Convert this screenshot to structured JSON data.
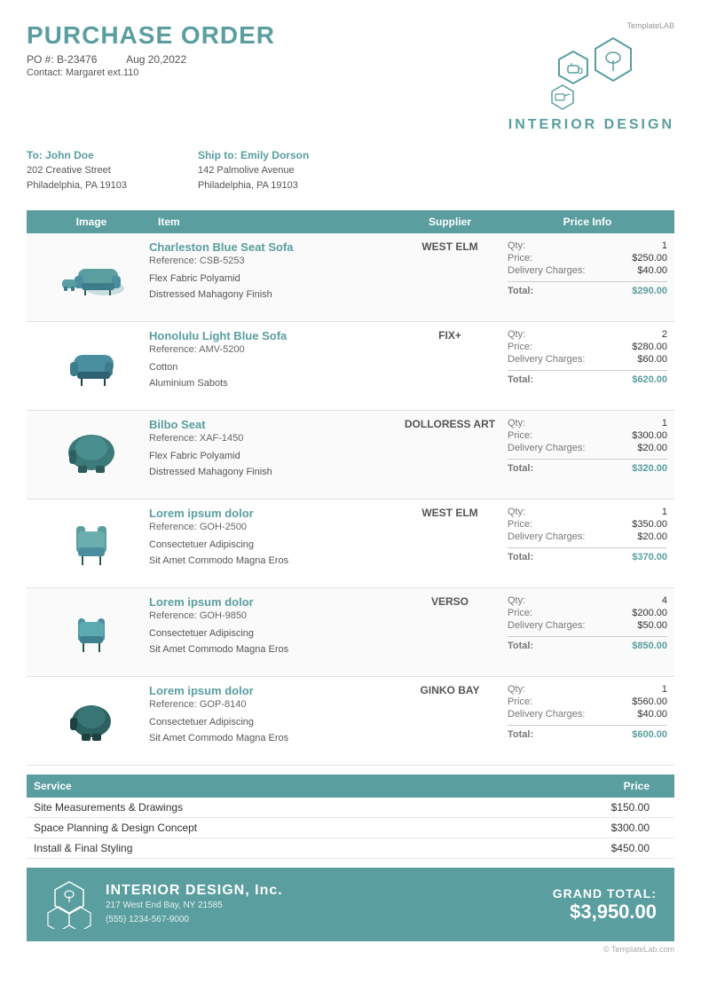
{
  "brand": "TemplateLAB",
  "header": {
    "title": "PURCHASE ORDER",
    "po_number": "PO #: B-23476",
    "date": "Aug 20,2022",
    "contact": "Contact: Margaret ext.110"
  },
  "logo": {
    "text": "INTERIOR DESIGN"
  },
  "to": {
    "label": "To: John Doe",
    "line1": "202 Creative Street",
    "line2": "Philadelphia, PA 19103"
  },
  "ship_to": {
    "label": "Ship to: Emily Dorson",
    "line1": "142 Palmolive Avenue",
    "line2": "Philadelphia, PA 19103"
  },
  "table": {
    "headers": [
      "Image",
      "Item",
      "Supplier",
      "Price Info"
    ],
    "rows": [
      {
        "item_name": "Charleston Blue Seat Sofa",
        "item_ref": "Reference: CSB-5253",
        "item_details": [
          "Flex Fabric Polyamid",
          "Distressed Mahagony Finish"
        ],
        "supplier": "WEST ELM",
        "qty": "1",
        "price": "$250.00",
        "delivery": "$40.00",
        "total": "$290.00",
        "sofa_color": "#5a9ea0"
      },
      {
        "item_name": "Honolulu Light Blue Sofa",
        "item_ref": "Reference: AMV-5200",
        "item_details": [
          "Cotton",
          "Aluminium Sabots"
        ],
        "supplier": "FIX+",
        "qty": "2",
        "price": "$280.00",
        "delivery": "$60.00",
        "total": "$620.00",
        "sofa_color": "#4a8fa0"
      },
      {
        "item_name": "Bilbo Seat",
        "item_ref": "Reference: XAF-1450",
        "item_details": [
          "Flex Fabric Polyamid",
          "Distressed Mahagony Finish"
        ],
        "supplier": "DOLLORESS ART",
        "qty": "1",
        "price": "$300.00",
        "delivery": "$20.00",
        "total": "$320.00",
        "sofa_color": "#3d7a7a"
      },
      {
        "item_name": "Lorem ipsum dolor",
        "item_ref": "Reference: GOH-2500",
        "item_details": [
          "Consectetuer Adipiscing",
          "Sit Amet Commodo Magna Eros"
        ],
        "supplier": "WEST ELM",
        "qty": "1",
        "price": "$350.00",
        "delivery": "$20.00",
        "total": "$370.00",
        "sofa_color": "#5a9ea0"
      },
      {
        "item_name": "Lorem ipsum dolor",
        "item_ref": "Reference: GOH-9850",
        "item_details": [
          "Consectetuer Adipiscing",
          "Sit Amet Commodo Magna Eros"
        ],
        "supplier": "VERSO",
        "qty": "4",
        "price": "$200.00",
        "delivery": "$50.00",
        "total": "$850.00",
        "sofa_color": "#4a8fa0"
      },
      {
        "item_name": "Lorem ipsum dolor",
        "item_ref": "Reference: GOP-8140",
        "item_details": [
          "Consectetuer Adipiscing",
          "Sit Amet Commodo Magna Eros"
        ],
        "supplier": "GINKO BAY",
        "qty": "1",
        "price": "$560.00",
        "delivery": "$40.00",
        "total": "$600.00",
        "sofa_color": "#2d6060"
      }
    ]
  },
  "services": {
    "headers": [
      "Service",
      "Price"
    ],
    "rows": [
      {
        "name": "Site Measurements & Drawings",
        "price": "$150.00"
      },
      {
        "name": "Space Planning & Design Concept",
        "price": "$300.00"
      },
      {
        "name": "Install & Final Styling",
        "price": "$450.00"
      }
    ]
  },
  "footer": {
    "company_name": "INTERIOR DESIGN, Inc.",
    "address": "217 West End Bay, NY 21585",
    "phone": "(555) 1234-567-9000",
    "grand_total_label": "GRAND TOTAL:",
    "grand_total_value": "$3,950.00",
    "copyright": "© TemplateLab.com"
  },
  "labels": {
    "qty": "Qty:",
    "price": "Price:",
    "delivery": "Delivery Charges:",
    "total": "Total:"
  }
}
